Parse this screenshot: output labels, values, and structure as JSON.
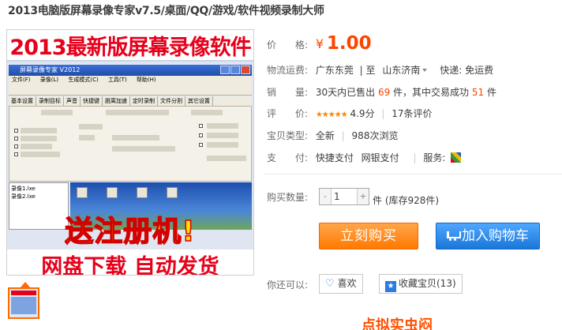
{
  "product": {
    "title": "2013电脑版屏幕录像专家v7.5/桌面/QQ/游戏/软件视频录制大师"
  },
  "main_image": {
    "banner_text": "2013最新版屏幕录像软件",
    "window_title": "屏幕录像专家 V2012",
    "menu_items": [
      "文件(F)",
      "录像(L)",
      "生成模式(C)",
      "工具(T)",
      "帮助(H)"
    ],
    "tabs": [
      "基本设置",
      "录制目标",
      "声音",
      "快捷键",
      "脱离加速",
      "定时录制",
      "文件分割",
      "其它设置"
    ],
    "list_items": [
      "录像1.lxe",
      "录像2.lxe"
    ],
    "overlay_text": "送注册机!",
    "bottom_text": "网盘下载  自动发货"
  },
  "price_row": {
    "label": "价　　格:",
    "currency": "¥",
    "value": "1.00"
  },
  "shipping_row": {
    "label": "物流运费:",
    "from": "广东东莞",
    "to_sep": "至",
    "to": "山东济南",
    "method": "快递: 免运费"
  },
  "sales_row": {
    "label": "销　　量:",
    "prefix": "30天内已售出",
    "sold": "69",
    "mid": "件，其中交易成功",
    "success": "51",
    "suffix": "件"
  },
  "rating_row": {
    "label": "评　　价:",
    "stars": "★★★★★",
    "score": "4.9分",
    "reviews": "17条评价"
  },
  "type_row": {
    "label": "宝贝类型:",
    "condition": "全新",
    "views": "988次浏览"
  },
  "pay_row": {
    "label": "支　　付:",
    "methods": [
      "快捷支付",
      "网银支付"
    ],
    "service_label": "服务:"
  },
  "quantity": {
    "label": "购买数量:",
    "minus": "-",
    "value": "1",
    "plus": "+",
    "unit": "件",
    "stock": "(库存928件)"
  },
  "buttons": {
    "buy_now": "立刻购买",
    "add_cart": "加入购物车"
  },
  "favorites": {
    "label": "你还可以:",
    "like": "喜欢",
    "collect": "收藏宝贝(13)"
  },
  "footer_cut_text": "点拟实虫闷"
}
